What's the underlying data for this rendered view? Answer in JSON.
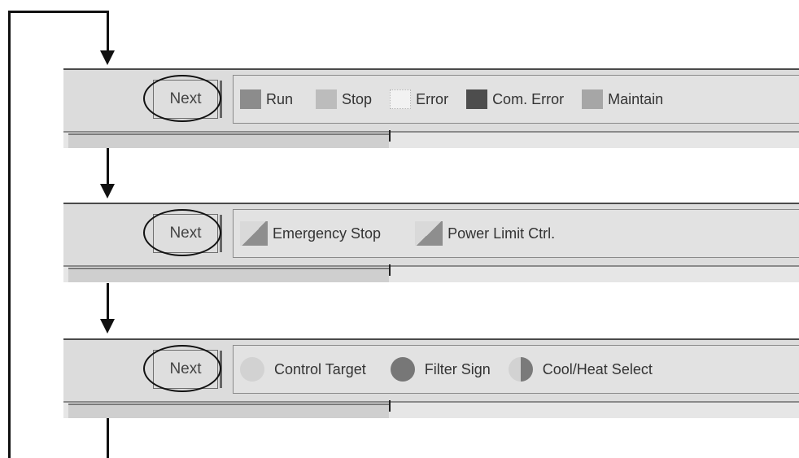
{
  "bar1": {
    "next_label": "Next",
    "legend": [
      "Run",
      "Stop",
      "Error",
      "Com. Error",
      "Maintain"
    ]
  },
  "bar2": {
    "next_label": "Next",
    "legend": [
      "Emergency Stop",
      "Power Limit Ctrl."
    ]
  },
  "bar3": {
    "next_label": "Next",
    "legend": [
      "Control Target",
      "Filter Sign",
      "Cool/Heat Select"
    ]
  }
}
